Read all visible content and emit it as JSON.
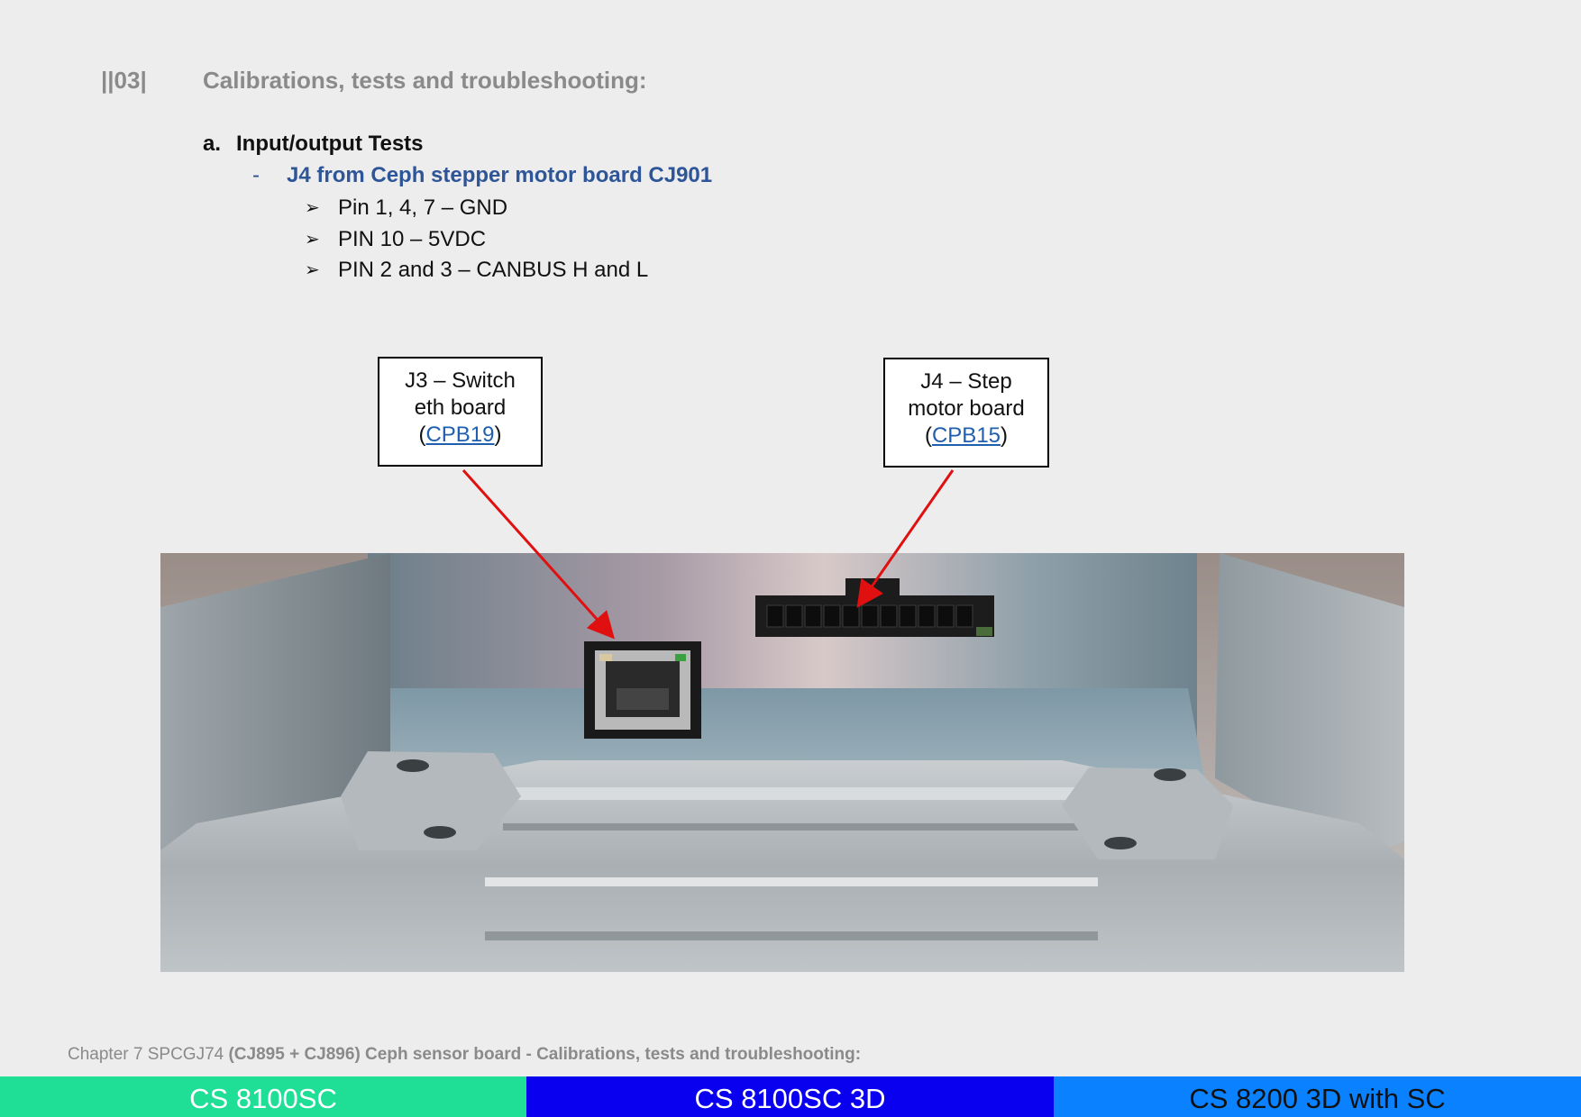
{
  "section": {
    "number": "||03|",
    "title": "Calibrations, tests and troubleshooting:"
  },
  "subsection": {
    "letter": "a.",
    "title": "Input/output Tests"
  },
  "item": {
    "dash": "-",
    "title": "J4 from Ceph stepper motor board CJ901"
  },
  "pins": [
    {
      "arrow": "➢",
      "text": "Pin 1, 4, 7 – GND"
    },
    {
      "arrow": "➢",
      "text": "PIN 10 – 5VDC"
    },
    {
      "arrow": "➢",
      "text": "PIN 2 and 3 – CANBUS H and L"
    }
  ],
  "callouts": {
    "j3": {
      "line1": "J3 – Switch",
      "line2": "eth board",
      "open": "(",
      "link": "CPB19",
      "close": ")"
    },
    "j4": {
      "line1": "J4 – Step",
      "line2": "motor board",
      "open": "(",
      "link": "CPB15",
      "close": ")"
    }
  },
  "footer": {
    "prefix": "Chapter 7 SPCGJ74",
    "bold": "(CJ895 + CJ896) Ceph sensor board - Calibrations, tests and troubleshooting:"
  },
  "bands": [
    {
      "label": "CS 8100SC",
      "bg": "#1fde96",
      "fg": "#ffffff"
    },
    {
      "label": "CS 8100SC 3D",
      "bg": "#0a00f0",
      "fg": "#ffffff"
    },
    {
      "label": "CS 8200 3D with SC",
      "bg": "#0a82ff",
      "fg": "#111111"
    }
  ],
  "colors": {
    "arrow": "#e01010",
    "link": "#1f5fae",
    "heading_blue": "#2e5597"
  }
}
